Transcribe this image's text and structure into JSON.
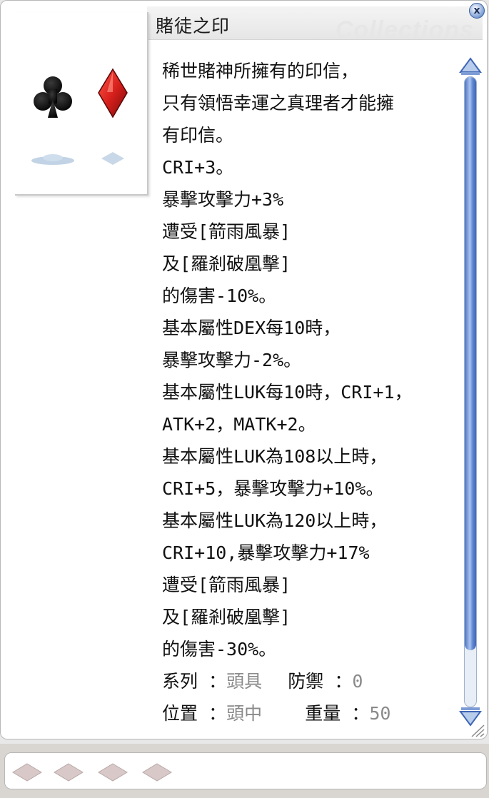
{
  "window": {
    "title": "賭徒之印",
    "watermark": "Collections",
    "close_glyph": "x"
  },
  "item_image": {
    "icon_name": "club-and-diamond-card-suits-icon",
    "colors": {
      "club": "#101010",
      "diamond": "#c0181c"
    }
  },
  "description": {
    "lines": [
      "稀世賭神所擁有的印信，",
      "只有領悟幸運之真理者才能擁",
      "有印信。",
      "CRI+3。",
      "暴擊攻擊力+3%",
      "遭受[箭雨風暴]",
      "及[羅剎破凰擊]",
      "的傷害-10%。",
      "基本屬性DEX每10時，",
      "暴擊攻擊力-2%。",
      "基本屬性LUK每10時，CRI+1，",
      "ATK+2，MATK+2。",
      "基本屬性LUK為108以上時，",
      "CRI+5，暴擊攻擊力+10%。",
      "基本屬性LUK為120以上時，",
      "CRI+10,暴擊攻擊力+17%",
      "遭受[箭雨風暴]",
      "及[羅剎破凰擊]",
      "的傷害-30%。"
    ],
    "stats": {
      "type_label": "系列",
      "type_value": "頭具",
      "defense_label": "防禦",
      "defense_value": "0",
      "position_label": "位置",
      "position_value": "頭中",
      "weight_label": "重量",
      "weight_value": "50",
      "separator": "："
    }
  },
  "scrollbar": {
    "icon_up": "scroll-up-arrow-icon",
    "icon_down": "scroll-down-arrow-icon",
    "thumb_fraction": 0.91,
    "color": "#4d74c4"
  },
  "card_slots": {
    "count": 4,
    "slot_icon": "empty-card-slot-icon",
    "color": "#d8c8c8"
  }
}
